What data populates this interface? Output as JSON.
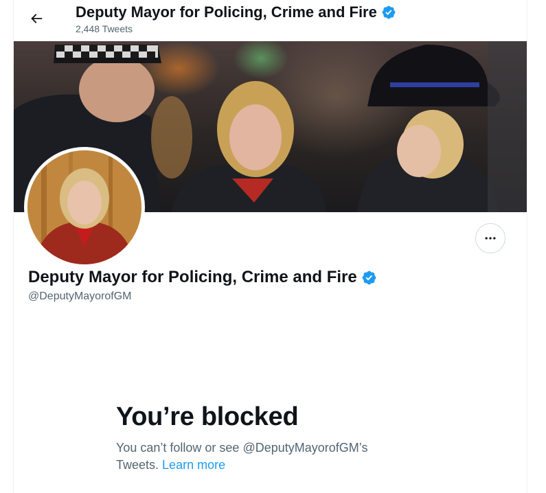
{
  "header": {
    "title": "Deputy Mayor for Policing, Crime and Fire",
    "tweet_count": "2,448 Tweets"
  },
  "profile": {
    "name": "Deputy Mayor for Policing, Crime and Fire",
    "handle": "@DeputyMayorofGM",
    "verified": true
  },
  "blocked": {
    "title": "You’re blocked",
    "message": "You can’t follow or see @DeputyMayorofGM’s Tweets.",
    "link": "Learn more"
  },
  "icons": {
    "back": "arrow-left-icon",
    "verified": "verified-badge-icon",
    "more": "more-options-icon"
  },
  "colors": {
    "accent": "#1d9bf0",
    "text_primary": "#0f1419",
    "text_secondary": "#536471",
    "border": "#cfd9de"
  }
}
